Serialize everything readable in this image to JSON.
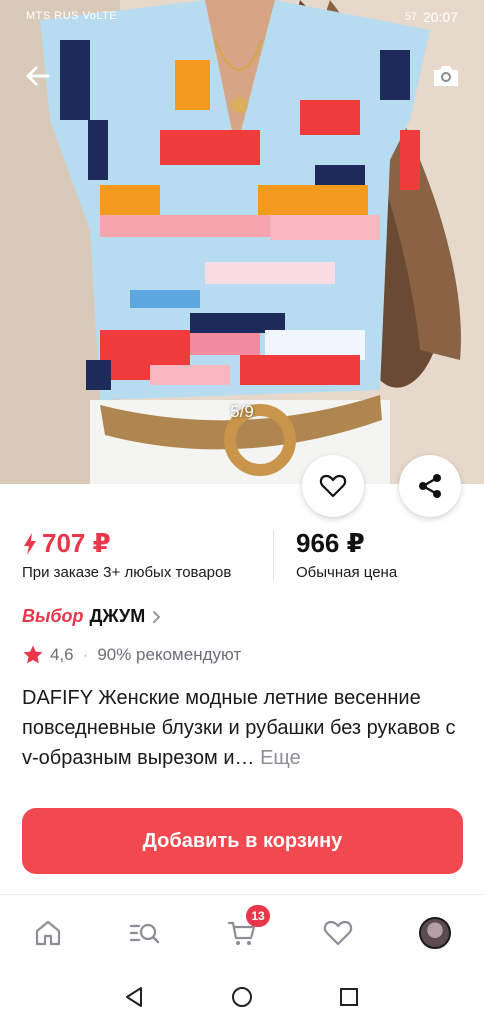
{
  "status_bar": {
    "carrier": "MTS RUS",
    "network": "VoLTE",
    "battery": "57",
    "time": "20:07"
  },
  "gallery": {
    "counter": "5/9"
  },
  "pricing": {
    "promo_price": "707 ₽",
    "promo_label": "При заказе 3+ любых товаров",
    "regular_price": "966 ₽",
    "regular_label": "Обычная цена"
  },
  "brand": {
    "pick_label": "Выбор",
    "name": "ДЖУМ"
  },
  "rating": {
    "value": "4,6",
    "recommend": "90% рекомендуют"
  },
  "product": {
    "title": "DAFIFY Женские модные летние весенние повседневные блузки и рубашки без рукавов с v-образным вырезом и…",
    "more": "Еще"
  },
  "actions": {
    "add_to_cart": "Добавить в корзину"
  },
  "bottom_nav": {
    "cart_badge": "13"
  },
  "colors": {
    "accent": "#e8374a",
    "cart_button": "#f2484f"
  },
  "icons": {
    "back": "arrow-left-icon",
    "camera": "camera-icon",
    "favorite": "heart-icon",
    "share": "share-icon",
    "lightning": "lightning-icon",
    "star": "star-icon",
    "home": "home-icon",
    "catalog": "catalog-search-icon",
    "cart": "cart-icon",
    "favorites_nav": "heart-icon",
    "profile": "avatar"
  }
}
